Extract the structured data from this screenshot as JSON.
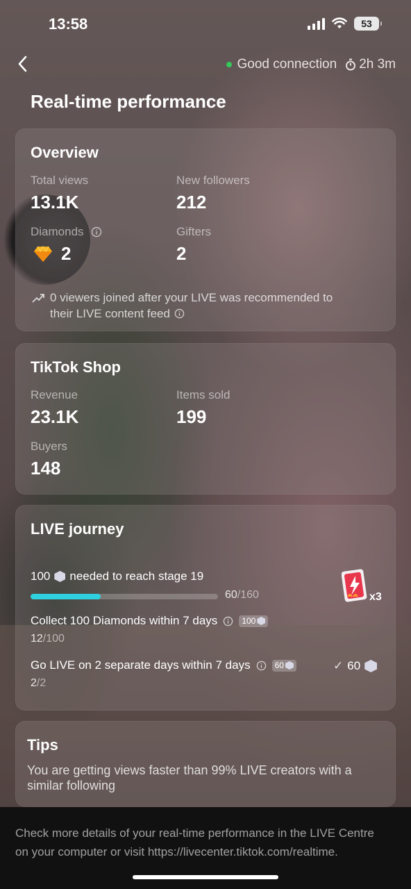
{
  "status_bar": {
    "time": "13:58",
    "battery": "53"
  },
  "header": {
    "connection": "Good connection",
    "duration": "2h 3m",
    "title": "Real-time performance"
  },
  "overview": {
    "title": "Overview",
    "total_views_label": "Total views",
    "total_views": "13.1K",
    "new_followers_label": "New followers",
    "new_followers": "212",
    "diamonds_label": "Diamonds",
    "diamonds": "2",
    "gifters_label": "Gifters",
    "gifters": "2",
    "note_line1": "0 viewers joined after your LIVE was recommended to",
    "note_line2": "their LIVE content feed"
  },
  "shop": {
    "title": "TikTok Shop",
    "revenue_label": "Revenue",
    "revenue": "23.1K",
    "items_sold_label": "Items sold",
    "items_sold": "199",
    "buyers_label": "Buyers",
    "buyers": "148"
  },
  "journey": {
    "title": "LIVE journey",
    "stage_prefix": "100",
    "stage_text": "needed to reach stage 19",
    "progress_current": "60",
    "progress_total": "/160",
    "progress_fraction": 0.375,
    "reward_multiplier": "x3",
    "tasks": [
      {
        "label": "Collect 100 Diamonds within 7 days",
        "chip": "100",
        "done": "12",
        "total": "/100"
      },
      {
        "label": "Go LIVE on 2 separate days within 7 days",
        "chip": "60",
        "done": "2",
        "total": "/2",
        "reward": "60"
      }
    ]
  },
  "tips": {
    "title": "Tips",
    "text": "You are getting views faster than 99% LIVE creators with a similar following"
  },
  "footer": {
    "text": "Check more details of your real-time performance in the LIVE Centre on your computer or visit https://livecenter.tiktok.com/realtime."
  }
}
